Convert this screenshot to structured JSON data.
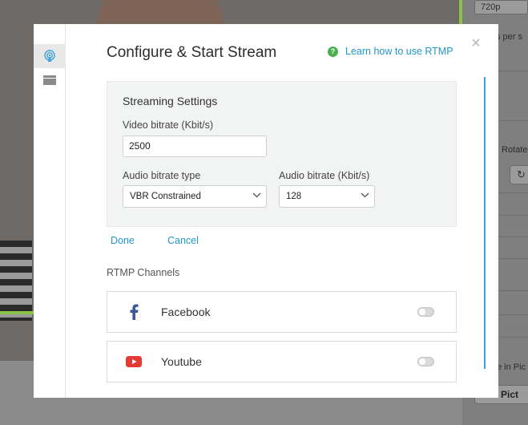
{
  "background": {
    "resolution_value": "720p",
    "per_sec_text": "s per s",
    "rotate_label": "Rotate",
    "pip_text": "e in Pic",
    "add_picture_label": "dd Pict",
    "rotate_icon": "rotate-icon"
  },
  "sidebar": {
    "items": [
      {
        "icon": "broadcast-icon",
        "active": true
      },
      {
        "icon": "film-icon",
        "active": false
      }
    ]
  },
  "dialog": {
    "title": "Configure & Start Stream",
    "help_link": "Learn how to use RTMP",
    "help_icon": "question-circle-icon",
    "close_glyph": "×"
  },
  "streaming_settings": {
    "title": "Streaming Settings",
    "video_bitrate_label": "Video bitrate (Kbit/s)",
    "video_bitrate_value": "2500",
    "audio_type_label": "Audio bitrate type",
    "audio_type_value": "VBR Constrained",
    "audio_bitrate_label": "Audio bitrate (Kbit/s)",
    "audio_bitrate_value": "128"
  },
  "actions": {
    "done": "Done",
    "cancel": "Cancel"
  },
  "rtmp": {
    "section_title": "RTMP Channels",
    "channels": [
      {
        "name": "Facebook",
        "icon": "facebook-icon",
        "enabled": false
      },
      {
        "name": "Youtube",
        "icon": "youtube-icon",
        "enabled": false
      }
    ]
  },
  "colors": {
    "accent": "#2196c9",
    "help_green": "#4caf50",
    "youtube_red": "#e53935",
    "facebook_blue": "#3b5998"
  }
}
